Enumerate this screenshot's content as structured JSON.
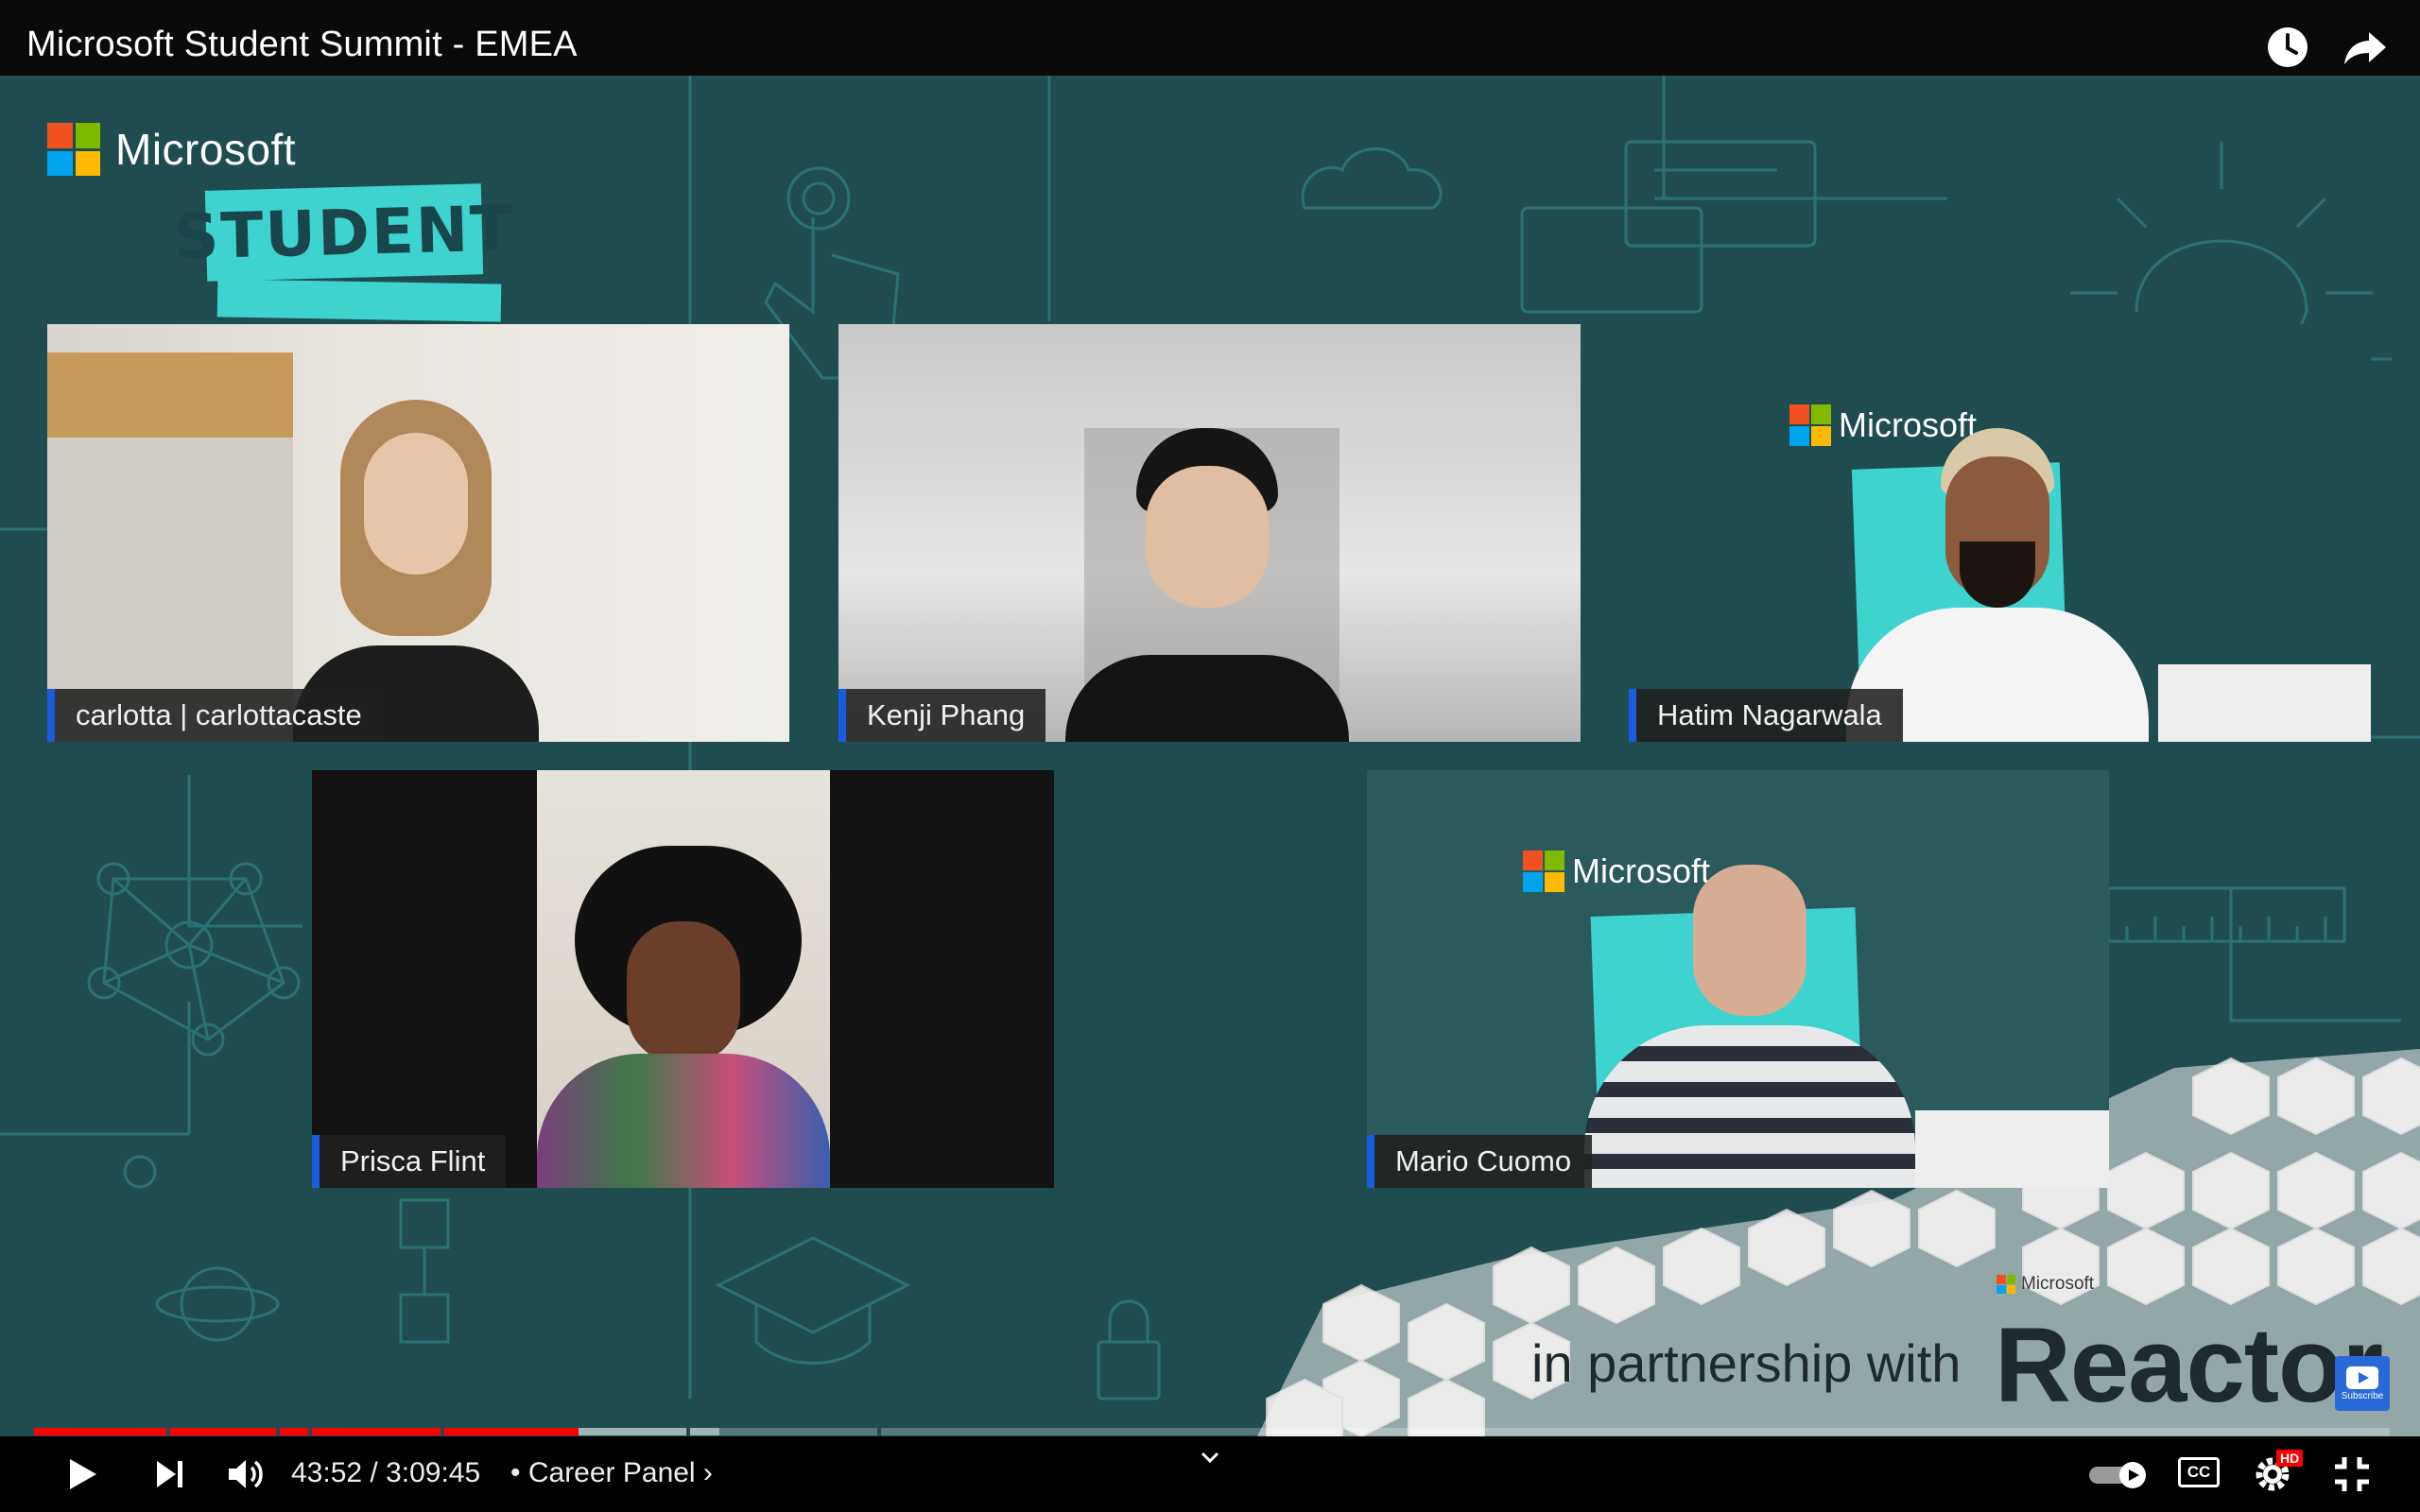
{
  "window": {
    "title": "Microsoft Student Summit - EMEA"
  },
  "top_actions": {
    "watch_later_icon": "clock-icon",
    "share_icon": "share-arrow-icon"
  },
  "branding": {
    "microsoft_label": "Microsoft",
    "student_badge": "STUDENT",
    "partner_text": "in partnership with",
    "reactor_label": "Reactor",
    "reactor_small_label": "Microsoft",
    "subscribe_label": "Subscribe",
    "ms_colors": [
      "#f25022",
      "#7fba00",
      "#00a4ef",
      "#ffb900"
    ]
  },
  "participants": [
    {
      "name": "carlotta | carlottacaste"
    },
    {
      "name": "Kenji Phang"
    },
    {
      "name": "Hatim Nagarwala"
    },
    {
      "name": "Prisca Flint"
    },
    {
      "name": "Mario Cuomo"
    }
  ],
  "player": {
    "current_time": "43:52",
    "duration": "3:09:45",
    "time_display": "43:52 / 3:09:45",
    "chapter_label": "• Career Panel ›",
    "played_fraction": 0.231,
    "buffered_fraction": 0.2,
    "cc_label": "CC",
    "hd_badge": "HD",
    "accent_color": "#ff0000",
    "stage_color": "#1f4c4f"
  },
  "controls": {
    "play_icon": "play-icon",
    "next_icon": "next-icon",
    "volume_icon": "volume-icon",
    "autoplay_icon": "autoplay-toggle-icon",
    "settings_icon": "gear-icon",
    "fullscreen_exit_icon": "exit-fullscreen-icon",
    "chapter_dropdown_icon": "chevron-down-icon"
  }
}
